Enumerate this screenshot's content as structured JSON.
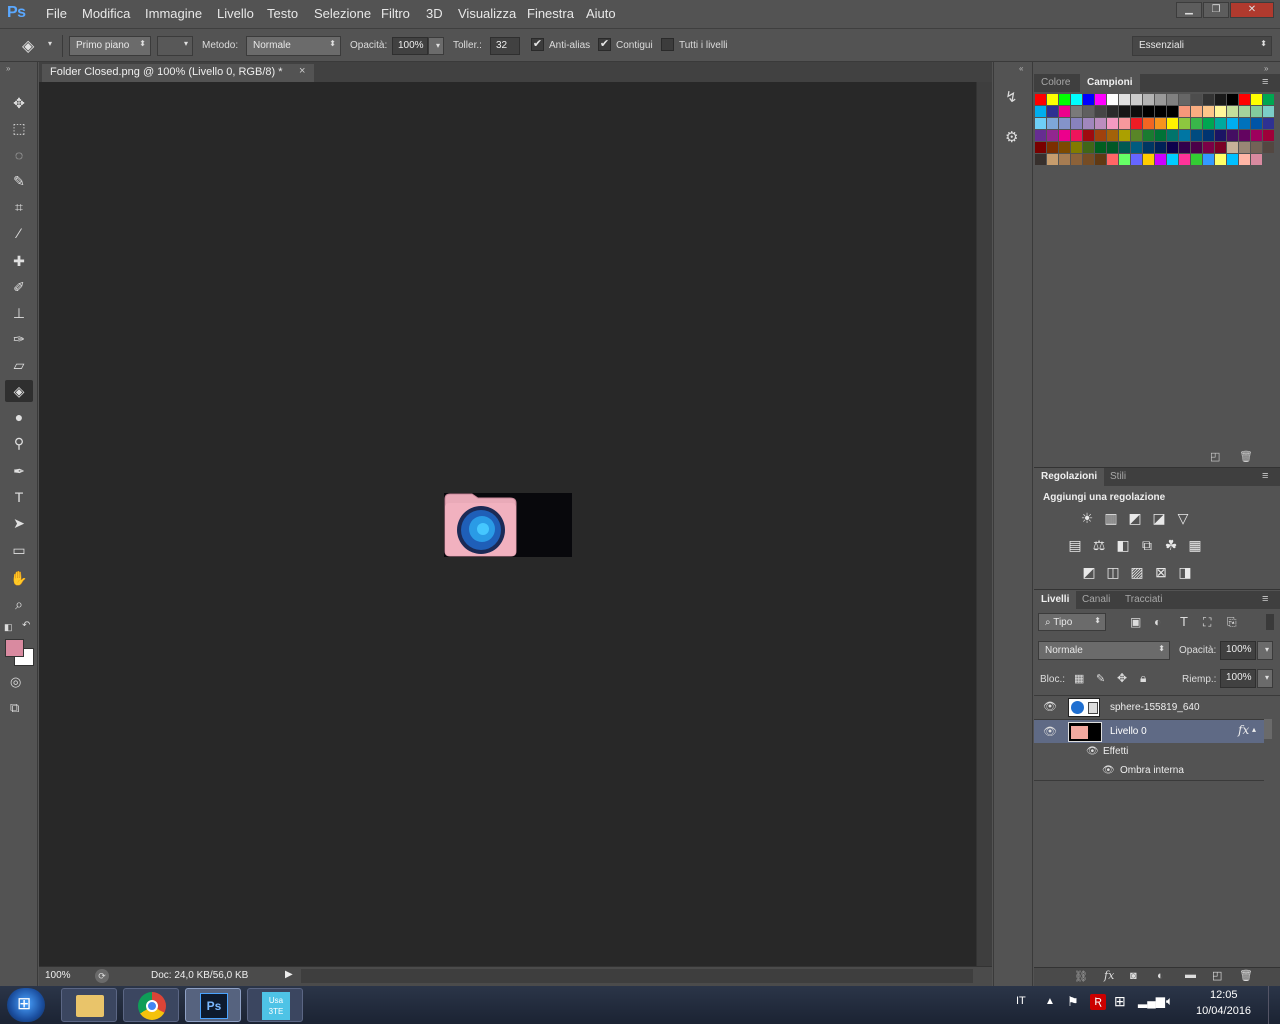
{
  "app": {
    "logo": "Ps"
  },
  "menu": [
    "File",
    "Modifica",
    "Immagine",
    "Livello",
    "Testo",
    "Selezione",
    "Filtro",
    "3D",
    "Visualizza",
    "Finestra",
    "Aiuto"
  ],
  "window_controls": {
    "minimize": "▁",
    "restore": "❐",
    "close": "✕"
  },
  "options": {
    "fill_source": "Primo piano",
    "mode_label": "Metodo:",
    "mode_value": "Normale",
    "opacity_label": "Opacità:",
    "opacity_value": "100%",
    "tolerance_label": "Toller.:",
    "tolerance_value": "32",
    "antialias_label": "Anti-alias",
    "antialias_checked": true,
    "contiguous_label": "Contigui",
    "contiguous_checked": true,
    "all_layers_label": "Tutti i livelli",
    "all_layers_checked": false,
    "workspace": "Essenziali"
  },
  "document": {
    "tab_title": "Folder Closed.png @ 100% (Livello 0, RGB/8) *",
    "close_glyph": "×",
    "zoom": "100%",
    "doc_info": "Doc: 24,0 KB/56,0 KB"
  },
  "tools": [
    {
      "name": "move-tool-icon",
      "glyph": "✥"
    },
    {
      "name": "marquee-tool-icon",
      "glyph": "⬚"
    },
    {
      "name": "lasso-tool-icon",
      "glyph": "◌"
    },
    {
      "name": "quick-selection-tool-icon",
      "glyph": "✎"
    },
    {
      "name": "crop-tool-icon",
      "glyph": "⌗"
    },
    {
      "name": "eyedropper-tool-icon",
      "glyph": "⁄"
    },
    {
      "name": "healing-brush-tool-icon",
      "glyph": "✚"
    },
    {
      "name": "brush-tool-icon",
      "glyph": "✐"
    },
    {
      "name": "clone-stamp-tool-icon",
      "glyph": "⊥"
    },
    {
      "name": "history-brush-tool-icon",
      "glyph": "✑"
    },
    {
      "name": "eraser-tool-icon",
      "glyph": "▱"
    },
    {
      "name": "paint-bucket-tool-icon",
      "glyph": "◈"
    },
    {
      "name": "blur-tool-icon",
      "glyph": "●"
    },
    {
      "name": "dodge-tool-icon",
      "glyph": "⚲"
    },
    {
      "name": "pen-tool-icon",
      "glyph": "✒"
    },
    {
      "name": "type-tool-icon",
      "glyph": "T"
    },
    {
      "name": "path-selection-tool-icon",
      "glyph": "➤"
    },
    {
      "name": "rectangle-tool-icon",
      "glyph": "▭"
    },
    {
      "name": "hand-tool-icon",
      "glyph": "✋"
    },
    {
      "name": "zoom-tool-icon",
      "glyph": "⌕"
    }
  ],
  "colors": {
    "foreground": "#d98aa0",
    "background": "#ffffff",
    "canvas_bg": "#282828"
  },
  "swatches_panel": {
    "tab1": "Colore",
    "tab2": "Campioni"
  },
  "swatches": [
    "#ff0000",
    "#ffff00",
    "#00ff00",
    "#00ffff",
    "#0000ff",
    "#ff00ff",
    "#ffffff",
    "#e0e0e0",
    "#cccccc",
    "#b3b3b3",
    "#999999",
    "#808080",
    "#666666",
    "#4d4d4d",
    "#333333",
    "#1a1a1a",
    "#000000",
    "#ff0000",
    "#ffff00",
    "#00a651",
    "#00aeef",
    "#2e3192",
    "#ec008c",
    "#7a7a7a",
    "#5f5f5f",
    "#454545",
    "#2b2b2b",
    "#151515",
    "#0d0d0d",
    "#000000",
    "#000000",
    "#000000",
    "#f7977a",
    "#f9ad81",
    "#fdc68a",
    "#fff79a",
    "#c4df9b",
    "#a3d39c",
    "#82ca9d",
    "#7bcdc8",
    "#6ecff6",
    "#7ea7d8",
    "#8493ca",
    "#8882be",
    "#a187be",
    "#bc8dbf",
    "#f49ac2",
    "#f6989d",
    "#ed1c24",
    "#f26522",
    "#f7941d",
    "#fff200",
    "#8dc73f",
    "#39b54a",
    "#00a651",
    "#00a99d",
    "#00aeef",
    "#0072bc",
    "#0054a6",
    "#2e3192",
    "#662d91",
    "#92278f",
    "#ec008c",
    "#ed145b",
    "#9e0b0f",
    "#a0410d",
    "#a36209",
    "#aba000",
    "#598527",
    "#1a7b30",
    "#007236",
    "#00746b",
    "#0076a3",
    "#004b80",
    "#003471",
    "#1b1464",
    "#440e62",
    "#630460",
    "#9e005d",
    "#9e0039",
    "#790000",
    "#7b2e00",
    "#7d4900",
    "#827b00",
    "#406618",
    "#005e20",
    "#005826",
    "#005952",
    "#005b7f",
    "#003663",
    "#002157",
    "#0d004c",
    "#32004b",
    "#4b0049",
    "#7b0046",
    "#7a0026",
    "#c7b299",
    "#998675",
    "#736357",
    "#534741",
    "#37302d",
    "#c69c6d",
    "#a67c52",
    "#8c6239",
    "#754c24",
    "#603913",
    "#ff6666",
    "#66ff66",
    "#6666ff",
    "#ffcc00",
    "#cc00ff",
    "#00ccff",
    "#ff3399",
    "#33cc33",
    "#3399ff",
    "#ffff66",
    "#00c0ff",
    "#ffb6a6",
    "#d98aa0"
  ],
  "adjustments_panel": {
    "tab1": "Regolazioni",
    "tab2": "Stili",
    "heading": "Aggiungi una regolazione"
  },
  "adjustment_icons": [
    [
      "brightness-icon",
      "levels-icon",
      "curves-icon",
      "exposure-icon",
      "vibrance-icon"
    ],
    [
      "hue-saturation-icon",
      "color-balance-icon",
      "black-white-icon",
      "photo-filter-icon",
      "channel-mixer-icon",
      "color-lookup-icon"
    ],
    [
      "invert-icon",
      "posterize-icon",
      "threshold-icon",
      "selective-color-icon",
      "gradient-map-icon"
    ]
  ],
  "layers_panel": {
    "tab1": "Livelli",
    "tab2": "Canali",
    "tab3": "Tracciati",
    "filter_kind": "Tipo",
    "blend_mode": "Normale",
    "opacity_label": "Opacità:",
    "opacity_value": "100%",
    "lock_label": "Bloc.:",
    "fill_label": "Riemp.:",
    "fill_value": "100%",
    "fx_glyph": "fx",
    "layers": [
      {
        "name": "sphere-155819_640",
        "selected": false
      },
      {
        "name": "Livello 0",
        "selected": true
      }
    ],
    "effects_label": "Effetti",
    "effect_name": "Ombra interna"
  },
  "taskbar": {
    "language": "IT",
    "time": "12:05",
    "date": "10/04/2016",
    "usa3te": "Usa 3TE"
  }
}
